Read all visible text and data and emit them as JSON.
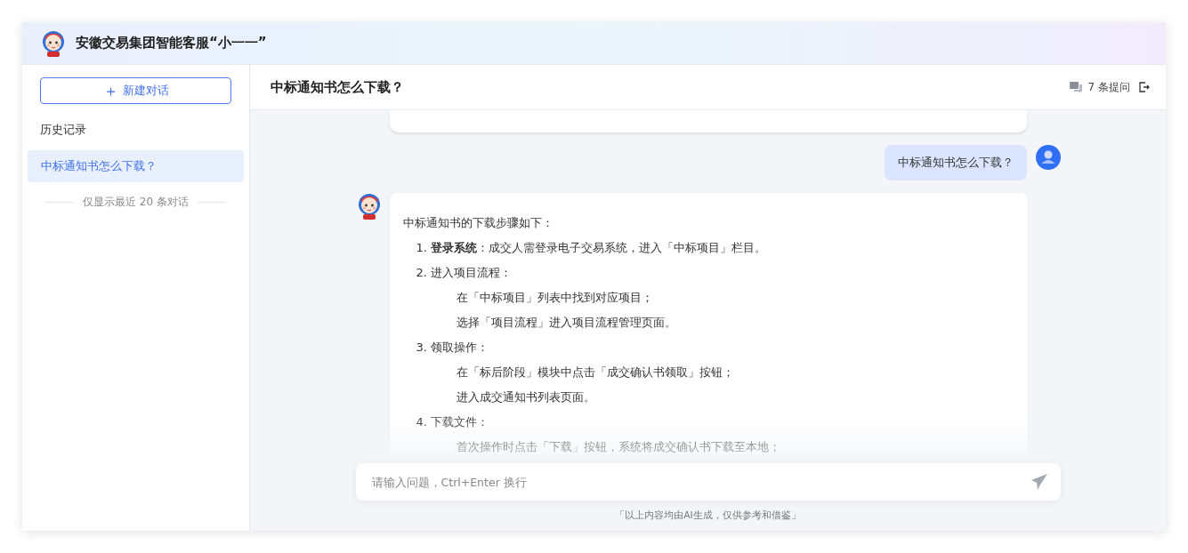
{
  "header": {
    "title": "安徽交易集团智能客服“小一一”"
  },
  "sidebar": {
    "new_chat_button": {
      "icon": "＋",
      "label": "新建对话"
    },
    "history_label": "历史记录",
    "conversations": [
      {
        "title": "中标通知书怎么下载？",
        "selected": true
      }
    ],
    "footnote": "仅显示最近 20 条对话"
  },
  "main": {
    "title": "中标通知书怎么下载？",
    "question_count": "7 条提问",
    "messages": [
      {
        "kind": "user",
        "text": "中标通知书怎么下载？"
      },
      {
        "kind": "bot",
        "intro": "中标通知书的下载步骤如下：",
        "steps": [
          {
            "number": "1.",
            "text": "**登录系统**：成交人需登录电子交易系统，进入「中标项目」栏目。"
          },
          {
            "number": "2.",
            "text": "进入项目流程：",
            "sub": [
              "在「中标项目」列表中找到对应项目；",
              "选择「项目流程」进入项目流程管理页面。"
            ]
          },
          {
            "number": "3.",
            "text": "领取操作：",
            "sub": [
              "在「标后阶段」模块中点击「成交确认书领取」按钮；",
              "进入成交通知书列表页面。"
            ]
          },
          {
            "number": "4.",
            "text": "下载文件：",
            "sub": [
              "首次操作时点击「下载」按钮，系统将成交确认书下载至本地；"
            ]
          }
        ]
      }
    ],
    "input": {
      "placeholder": "请输入问题，Ctrl+Enter 换行"
    },
    "disclaimer": "「以上内容均由AI生成，仅供参考和借鉴」"
  }
}
